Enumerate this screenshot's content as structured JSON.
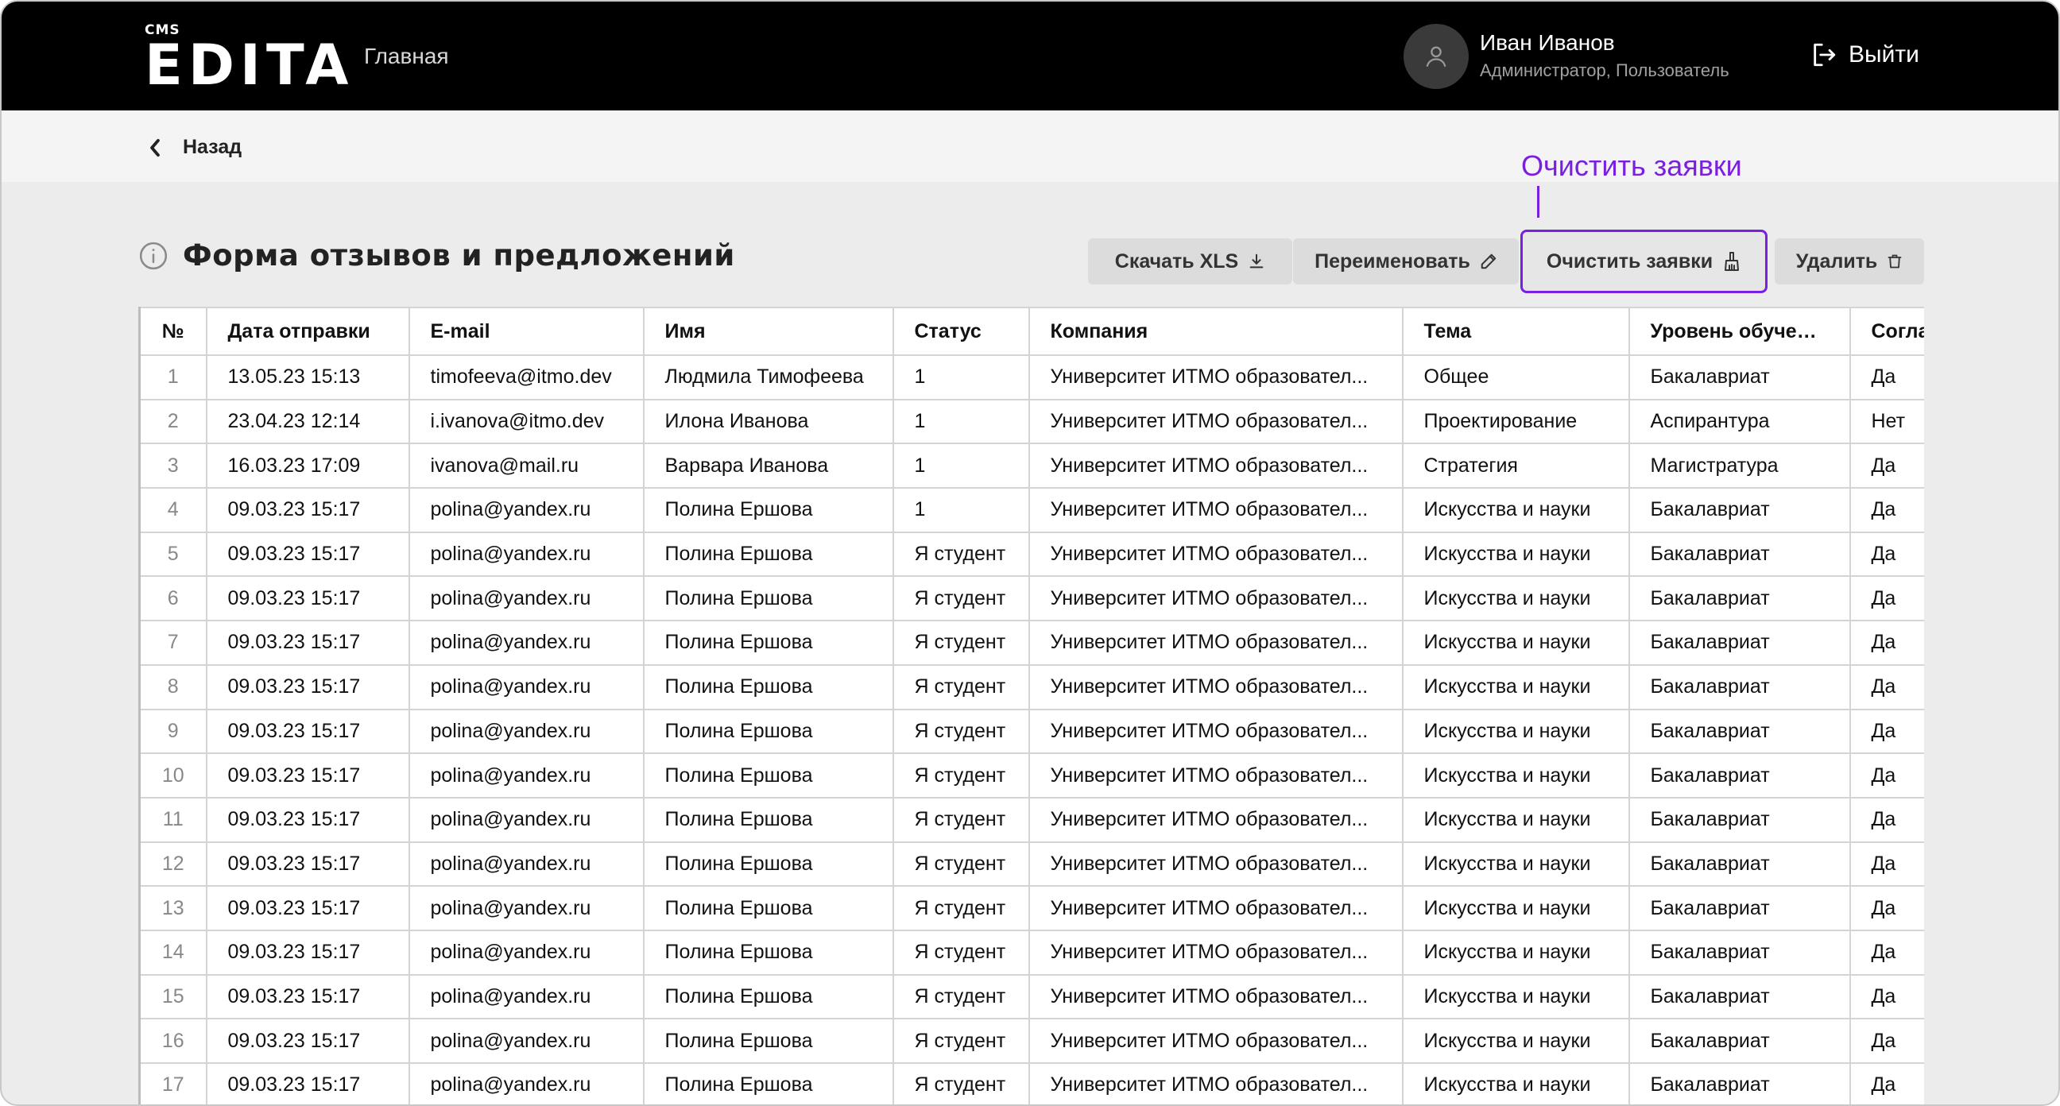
{
  "header": {
    "logo_small": "CMS",
    "logo_main": "EDITA",
    "nav_home": "Главная",
    "user_name": "Иван Иванов",
    "user_role": "Администратор, Пользователь",
    "logout_label": "Выйти"
  },
  "backbar": {
    "back_label": "Назад"
  },
  "page": {
    "title": "Форма отзывов и предложений",
    "annotation": "Очистить заявки"
  },
  "toolbar": {
    "download_label": "Скачать XLS",
    "rename_label": "Переименовать",
    "clear_label": "Очистить заявки",
    "delete_label": "Удалить"
  },
  "icons": {
    "info": "info-icon",
    "download": "download-icon",
    "rename": "pencil-icon",
    "clear": "broom-icon",
    "delete": "trash-icon",
    "back": "chevron-left-icon",
    "logout": "logout-icon",
    "avatar": "user-icon"
  },
  "colors": {
    "accent": "#7a1fe0",
    "header_bg": "#000000"
  },
  "table": {
    "columns": [
      "№",
      "Дата отправки",
      "E-mail",
      "Имя",
      "Статус",
      "Компания",
      "Тема",
      "Уровень обучения",
      "Согла"
    ],
    "rows": [
      [
        "1",
        "13.05.23 15:13",
        "timofeeva@itmo.dev",
        "Людмила Тимофеева",
        "1",
        "Университет ИТМО образовател...",
        "Общее",
        "Бакалавриат",
        "Да"
      ],
      [
        "2",
        "23.04.23 12:14",
        "i.ivanova@itmo.dev",
        "Илона Иванова",
        "1",
        "Университет ИТМО образовател...",
        "Проектирование",
        "Аспирантура",
        "Нет"
      ],
      [
        "3",
        "16.03.23 17:09",
        "ivanova@mail.ru",
        "Варвара Иванова",
        "1",
        "Университет ИТМО образовател...",
        "Стратегия",
        "Магистратура",
        "Да"
      ],
      [
        "4",
        "09.03.23 15:17",
        "polina@yandex.ru",
        "Полина Ершова",
        "1",
        "Университет ИТМО образовател...",
        "Искусства и науки",
        "Бакалавриат",
        "Да"
      ],
      [
        "5",
        "09.03.23 15:17",
        "polina@yandex.ru",
        "Полина Ершова",
        "Я студент",
        "Университет ИТМО образовател...",
        "Искусства и науки",
        "Бакалавриат",
        "Да"
      ],
      [
        "6",
        "09.03.23 15:17",
        "polina@yandex.ru",
        "Полина Ершова",
        "Я студент",
        "Университет ИТМО образовател...",
        "Искусства и науки",
        "Бакалавриат",
        "Да"
      ],
      [
        "7",
        "09.03.23 15:17",
        "polina@yandex.ru",
        "Полина Ершова",
        "Я студент",
        "Университет ИТМО образовател...",
        "Искусства и науки",
        "Бакалавриат",
        "Да"
      ],
      [
        "8",
        "09.03.23 15:17",
        "polina@yandex.ru",
        "Полина Ершова",
        "Я студент",
        "Университет ИТМО образовател...",
        "Искусства и науки",
        "Бакалавриат",
        "Да"
      ],
      [
        "9",
        "09.03.23 15:17",
        "polina@yandex.ru",
        "Полина Ершова",
        "Я студент",
        "Университет ИТМО образовател...",
        "Искусства и науки",
        "Бакалавриат",
        "Да"
      ],
      [
        "10",
        "09.03.23 15:17",
        "polina@yandex.ru",
        "Полина Ершова",
        "Я студент",
        "Университет ИТМО образовател...",
        "Искусства и науки",
        "Бакалавриат",
        "Да"
      ],
      [
        "11",
        "09.03.23 15:17",
        "polina@yandex.ru",
        "Полина Ершова",
        "Я студент",
        "Университет ИТМО образовател...",
        "Искусства и науки",
        "Бакалавриат",
        "Да"
      ],
      [
        "12",
        "09.03.23 15:17",
        "polina@yandex.ru",
        "Полина Ершова",
        "Я студент",
        "Университет ИТМО образовател...",
        "Искусства и науки",
        "Бакалавриат",
        "Да"
      ],
      [
        "13",
        "09.03.23 15:17",
        "polina@yandex.ru",
        "Полина Ершова",
        "Я студент",
        "Университет ИТМО образовател...",
        "Искусства и науки",
        "Бакалавриат",
        "Да"
      ],
      [
        "14",
        "09.03.23 15:17",
        "polina@yandex.ru",
        "Полина Ершова",
        "Я студент",
        "Университет ИТМО образовател...",
        "Искусства и науки",
        "Бакалавриат",
        "Да"
      ],
      [
        "15",
        "09.03.23 15:17",
        "polina@yandex.ru",
        "Полина Ершова",
        "Я студент",
        "Университет ИТМО образовател...",
        "Искусства и науки",
        "Бакалавриат",
        "Да"
      ],
      [
        "16",
        "09.03.23 15:17",
        "polina@yandex.ru",
        "Полина Ершова",
        "Я студент",
        "Университет ИТМО образовател...",
        "Искусства и науки",
        "Бакалавриат",
        "Да"
      ],
      [
        "17",
        "09.03.23 15:17",
        "polina@yandex.ru",
        "Полина Ершова",
        "Я студент",
        "Университет ИТМО образовател...",
        "Искусства и науки",
        "Бакалавриат",
        "Да"
      ]
    ]
  }
}
